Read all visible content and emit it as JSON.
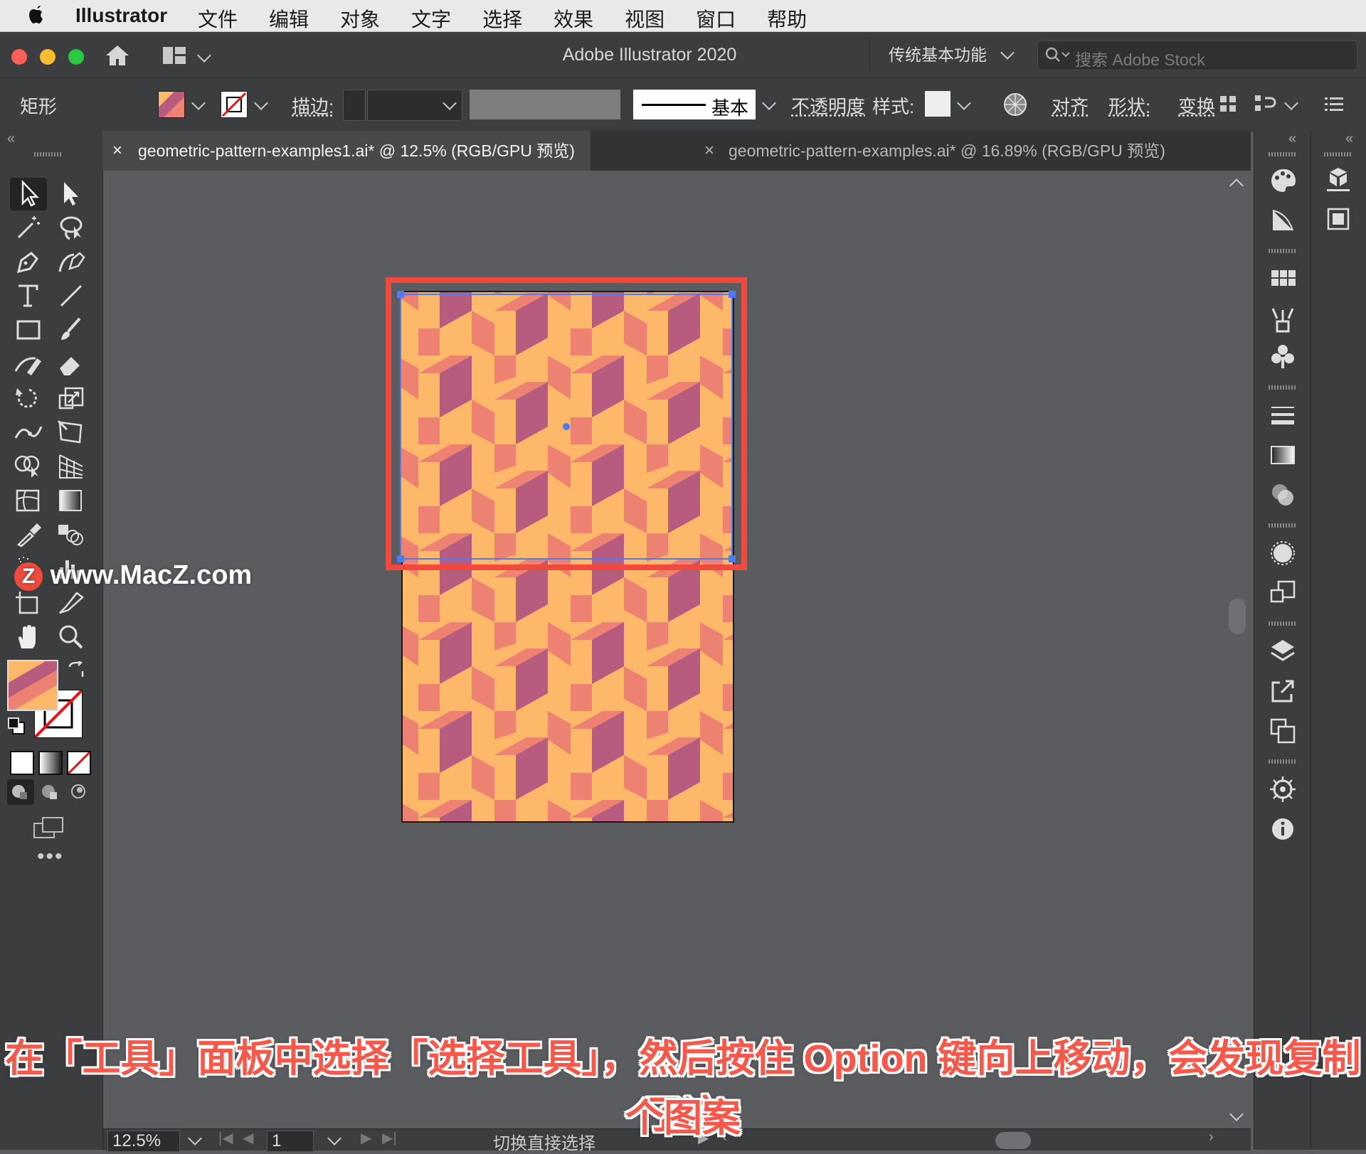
{
  "menubar": {
    "app_name": "Illustrator",
    "items": [
      "文件",
      "编辑",
      "对象",
      "文字",
      "选择",
      "效果",
      "视图",
      "窗口",
      "帮助"
    ]
  },
  "titlebar": {
    "title": "Adobe Illustrator 2020",
    "workspace": "传统基本功能",
    "stock_placeholder": "搜索 Adobe Stock"
  },
  "control": {
    "object_type": "矩形",
    "stroke_label": "描边:",
    "brush_label": "基本",
    "opacity_label": "不透明度",
    "style_label": "样式:",
    "align_label": "对齐",
    "shape_label": "形状:",
    "transform_label": "变换"
  },
  "tabs": [
    {
      "label": "geometric-pattern-examples1.ai* @ 12.5% (RGB/GPU 预览)",
      "active": true
    },
    {
      "label": "geometric-pattern-examples.ai* @ 16.89% (RGB/GPU 预览)",
      "active": false
    }
  ],
  "status": {
    "zoom": "12.5%",
    "page": "1",
    "message": "切换直接选择"
  },
  "watermark": "www.MacZ.com",
  "caption": {
    "line1": "在「工具」面板中选择「选择工具」，然后按住 Option 键向上移动，会发现复制了这",
    "line2": "个图案"
  },
  "colors": {
    "pattern_orange": "#fdb869",
    "pattern_coral": "#ee8272",
    "pattern_purple": "#b75c7e",
    "highlight_red": "#f04a3e",
    "selection_blue": "#4c7cf0",
    "caption_red": "#f6584a"
  },
  "icons": {
    "tools": [
      "selection-tool-icon",
      "direct-selection-tool-icon",
      "magic-wand-icon",
      "lasso-icon",
      "pen-tool-icon",
      "curvature-tool-icon",
      "type-tool-icon",
      "line-tool-icon",
      "rectangle-tool-icon",
      "paintbrush-icon",
      "shaper-tool-icon",
      "eraser-icon",
      "rotate-tool-icon",
      "scale-tool-icon",
      "width-tool-icon",
      "free-transform-icon",
      "shape-builder-icon",
      "perspective-grid-icon",
      "mesh-tool-icon",
      "gradient-tool-icon",
      "eyedropper-icon",
      "blend-tool-icon",
      "symbol-sprayer-icon",
      "graph-tool-icon",
      "artboard-tool-icon",
      "slice-tool-icon",
      "hand-tool-icon",
      "zoom-tool-icon"
    ],
    "panels": [
      "color-panel-icon",
      "color-guide-icon",
      "swatches-icon",
      "brushes-icon",
      "symbols-icon",
      "stroke-icon",
      "gradient-icon",
      "transparency-icon",
      "appearance-icon",
      "graphic-styles-icon",
      "layers-icon",
      "export-icon",
      "artboards-icon",
      "navigator-icon",
      "info-icon"
    ]
  }
}
